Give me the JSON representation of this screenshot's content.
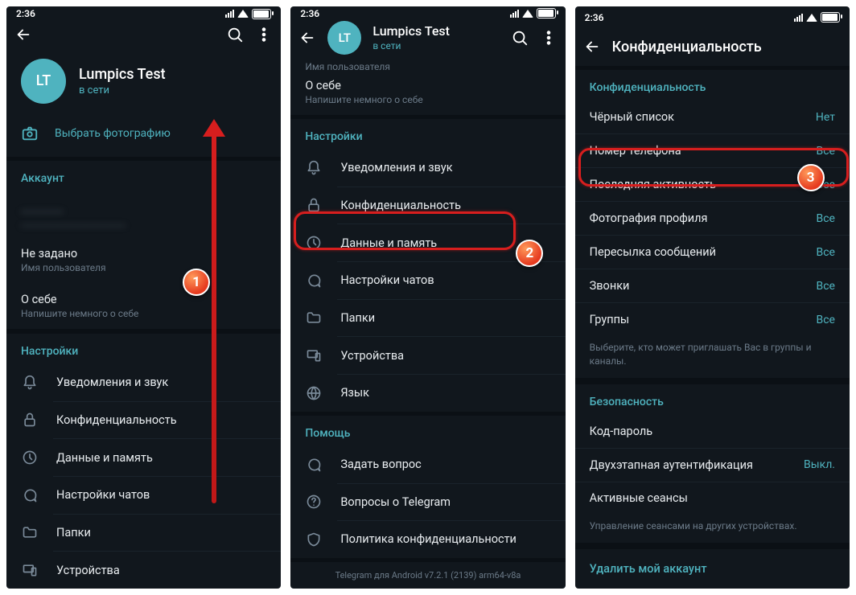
{
  "status": {
    "time": "2:36"
  },
  "avatar_letters": "LT",
  "profile": {
    "name": "Lumpics Test",
    "status": "в сети"
  },
  "p1": {
    "choose_photo": "Выбрать фотографию",
    "account_header": "Аккаунт",
    "acc_line1": "________",
    "acc_line2": "________________________",
    "not_set": "Не задано",
    "username_label": "Имя пользователя",
    "about": "О себе",
    "about_hint": "Напишите немного о себе",
    "settings_header": "Настройки",
    "items": [
      "Уведомления и звук",
      "Конфиденциальность",
      "Данные и память",
      "Настройки чатов",
      "Папки",
      "Устройства"
    ]
  },
  "p2": {
    "username_label": "Имя пользователя",
    "about": "О себе",
    "about_hint": "Напишите немного о себе",
    "settings_header": "Настройки",
    "items": [
      "Уведомления и звук",
      "Конфиденциальность",
      "Данные и память",
      "Настройки чатов",
      "Папки",
      "Устройства",
      "Язык"
    ],
    "help_header": "Помощь",
    "help_items": [
      "Задать вопрос",
      "Вопросы о Telegram",
      "Политика конфиденциальности"
    ],
    "footer": "Telegram для Android v7.2.1 (2139) arm64-v8a"
  },
  "p3": {
    "title": "Конфиденциальность",
    "privacy_header": "Конфиденциальность",
    "rows": [
      {
        "l": "Чёрный список",
        "v": "Нет"
      },
      {
        "l": "Номер телефона",
        "v": "Все"
      },
      {
        "l": "Последняя активность",
        "v": "Все"
      },
      {
        "l": "Фотография профиля",
        "v": "Все"
      },
      {
        "l": "Пересылка сообщений",
        "v": "Все"
      },
      {
        "l": "Звонки",
        "v": "Все"
      },
      {
        "l": "Группы",
        "v": "Все"
      }
    ],
    "groups_hint": "Выберите, кто может приглашать Вас в группы и каналы.",
    "security_header": "Безопасность",
    "sec": [
      {
        "l": "Код-пароль",
        "v": ""
      },
      {
        "l": "Двухэтапная аутентификация",
        "v": "Выкл."
      },
      {
        "l": "Активные сеансы",
        "v": ""
      }
    ],
    "sessions_hint": "Управление сеансами на других устройствах.",
    "delete": "Удалить мой аккаунт"
  },
  "badges": {
    "1": "1",
    "2": "2",
    "3": "3"
  }
}
